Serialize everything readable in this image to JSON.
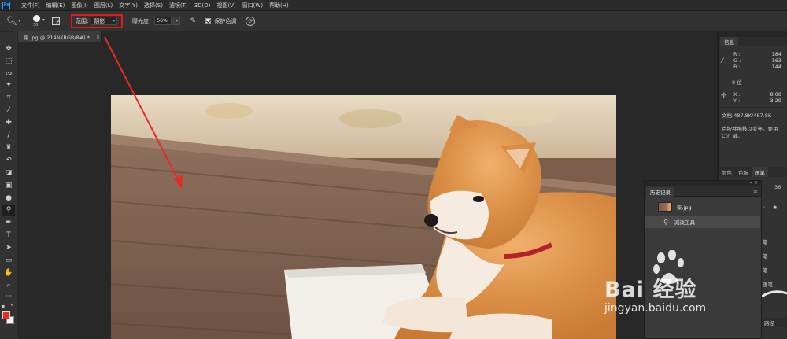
{
  "app": {
    "logo": "Ps"
  },
  "menu": [
    "文件(F)",
    "编辑(E)",
    "图像(I)",
    "图层(L)",
    "文字(Y)",
    "选择(S)",
    "滤镜(T)",
    "3D(D)",
    "视图(V)",
    "窗口(W)",
    "帮助(H)"
  ],
  "options": {
    "tool_icon": "dodge-tool-icon",
    "brush_size": "36",
    "range_label": "范围:",
    "range_value": "阴影",
    "exposure_label": "曝光度:",
    "exposure_value": "56%",
    "protect_tone_label": "保护色调",
    "protect_tone_checked": true
  },
  "document": {
    "tab_title": "柴.jpg @ 214%(RGB/8#) *",
    "close": "×"
  },
  "info_panel": {
    "tab": "信息",
    "r_label": "R :",
    "r_value": "184",
    "g_label": "G :",
    "g_value": "163",
    "b_label": "B :",
    "b_value": "144",
    "bits": "8 位",
    "x_label": "X :",
    "x_value": "8.08",
    "y_label": "Y :",
    "y_value": "3.29",
    "doc_size": "文档:487.8K/487.8K",
    "hint_line1": "点按并拖移以变亮。要用",
    "hint_line2": "Ctrl 键。"
  },
  "dock_tabs": {
    "color": "颜色",
    "swatches": "色板",
    "brush": "画笔",
    "size_value": "36"
  },
  "brush_list": [
    "笔",
    "笔",
    "笔",
    "画笔"
  ],
  "bottom_tab": "路径",
  "history": {
    "tab": "历史记录",
    "snapshot_label": "柴.jpg",
    "step_label": "减淡工具"
  },
  "watermark": {
    "brand": "Bai  经验",
    "url": "jingyan.baidu.com"
  },
  "colors": {
    "foreground": "#ea2a1f",
    "background": "#f5f5f5",
    "highlight_box": "#e11b1b",
    "annotation_arrow": "#e62b22"
  }
}
